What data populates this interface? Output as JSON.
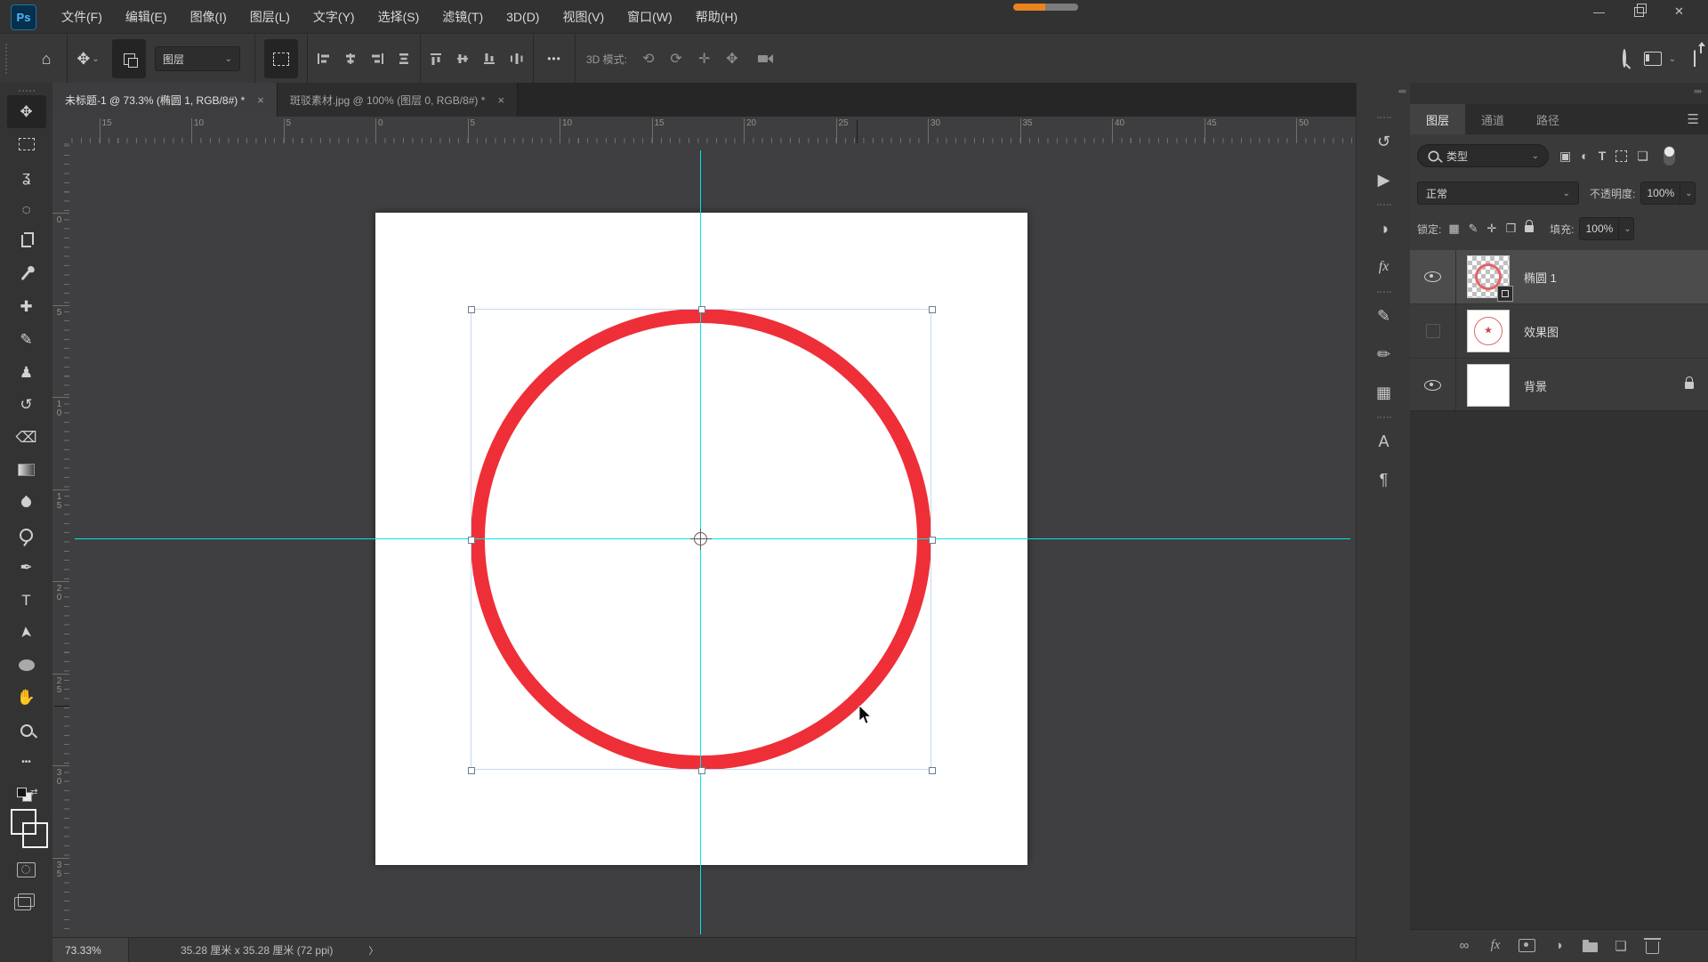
{
  "window": {
    "app_logo": "Ps",
    "controls": {
      "minimize": "—",
      "close": "✕"
    }
  },
  "menu_bar": {
    "items": [
      {
        "id": "file",
        "label": "文件(F)"
      },
      {
        "id": "edit",
        "label": "编辑(E)"
      },
      {
        "id": "image",
        "label": "图像(I)"
      },
      {
        "id": "layer",
        "label": "图层(L)"
      },
      {
        "id": "type",
        "label": "文字(Y)"
      },
      {
        "id": "select",
        "label": "选择(S)"
      },
      {
        "id": "filter",
        "label": "滤镜(T)"
      },
      {
        "id": "3d",
        "label": "3D(D)"
      },
      {
        "id": "view",
        "label": "视图(V)"
      },
      {
        "id": "window",
        "label": "窗口(W)"
      },
      {
        "id": "help",
        "label": "帮助(H)"
      }
    ]
  },
  "options_bar": {
    "tool_select_label": "图层",
    "mode_label": "3D 模式:",
    "more_label": "•••"
  },
  "icons": {
    "home": "⌂",
    "chevron_down": "⌄",
    "hamburger": "☰",
    "collapse_left": "««",
    "collapse_right": "»»",
    "rotate3d": "⟲",
    "roll3d": "⟳",
    "drag3d": "✛",
    "slide3d": "✥",
    "filter_image": "▣",
    "filter_adjust": "◐",
    "filter_type": "T",
    "filter_smart": "❏",
    "lock_checker": "▦",
    "lock_brush": "✎",
    "lock_position": "✛",
    "lock_artboard": "❐",
    "star": "★",
    "status_chevron": "〉",
    "mini_swap_arrow": "⇄"
  },
  "tabs": [
    {
      "label": "未标题-1 @ 73.3% (椭圆 1, RGB/8#) *",
      "close": "×",
      "active": true
    },
    {
      "label": "斑驳素材.jpg @ 100% (图层 0, RGB/8#) *",
      "close": "×",
      "active": false
    }
  ],
  "toolbar": {
    "tools": [
      {
        "name": "move-tool",
        "glyph": "✥",
        "active": true
      },
      {
        "name": "rect-marquee-tool",
        "shape": "marquee"
      },
      {
        "name": "lasso-tool",
        "glyph": "ʓ"
      },
      {
        "name": "quick-selection-tool",
        "glyph": "◌"
      },
      {
        "name": "crop-tool",
        "shape": "crop"
      },
      {
        "name": "eyedropper-tool",
        "shape": "dropper"
      },
      {
        "name": "spot-healing-tool",
        "glyph": "✚"
      },
      {
        "name": "brush-tool",
        "glyph": "✎"
      },
      {
        "name": "clone-stamp-tool",
        "glyph": "♟"
      },
      {
        "name": "history-brush-tool",
        "glyph": "↺"
      },
      {
        "name": "eraser-tool",
        "glyph": "⌫"
      },
      {
        "name": "gradient-tool",
        "shape": "grad"
      },
      {
        "name": "blur-tool",
        "shape": "drop"
      },
      {
        "name": "dodge-tool",
        "shape": "dodge"
      },
      {
        "name": "pen-tool",
        "glyph": "✒"
      },
      {
        "name": "type-tool",
        "glyph": "T"
      },
      {
        "name": "path-selection-tool",
        "glyph": "➤",
        "rot": true
      },
      {
        "name": "ellipse-tool",
        "shape": "ellipse"
      },
      {
        "name": "hand-tool",
        "glyph": "✋"
      },
      {
        "name": "zoom-tool",
        "shape": "mag"
      },
      {
        "name": "more-tools",
        "glyph": "•••"
      }
    ]
  },
  "rulers": {
    "top_labels": [
      "15",
      "10",
      "5",
      "0",
      "5",
      "10",
      "15",
      "20",
      "25",
      "30",
      "35",
      "40",
      "45",
      "50"
    ],
    "left_labels": [
      "0",
      "5",
      "10",
      "15",
      "20",
      "25",
      "30",
      "35"
    ]
  },
  "canvas": {
    "circle_color": "#ee2f38",
    "guide_color": "#00e4e6"
  },
  "status_bar": {
    "zoom": "73.33%",
    "doc_size": "35.28 厘米 x 35.28 厘米 (72 ppi)"
  },
  "panels": {
    "strip_icons": [
      {
        "name": "history-icon",
        "glyph": "↺"
      },
      {
        "name": "actions-icon",
        "glyph": "▶"
      },
      {
        "name": "adjustments-icon",
        "glyph": "◑"
      },
      {
        "name": "styles-icon",
        "glyph": "fx"
      },
      {
        "name": "brush-settings-icon",
        "glyph": "✎"
      },
      {
        "name": "brushes-icon",
        "glyph": "✏"
      },
      {
        "name": "patterns-icon",
        "glyph": "▦"
      },
      {
        "name": "character-icon",
        "glyph": "A"
      },
      {
        "name": "paragraph-icon",
        "glyph": "¶"
      }
    ],
    "tabs": [
      {
        "id": "layers",
        "label": "图层",
        "active": true
      },
      {
        "id": "channels",
        "label": "通道",
        "active": false
      },
      {
        "id": "paths",
        "label": "路径",
        "active": false
      }
    ],
    "filter": {
      "type_label": "类型"
    },
    "blend_mode": "正常",
    "opacity_label": "不透明度:",
    "opacity_value": "100%",
    "lock_label": "锁定:",
    "fill_label": "填充:",
    "fill_value": "100%",
    "layers": [
      {
        "id": "ellipse",
        "name": "椭圆 1",
        "visible": true,
        "selected": true,
        "locked": false,
        "thumb": "ellipse"
      },
      {
        "id": "effect",
        "name": "效果图",
        "visible": false,
        "selected": false,
        "locked": false,
        "thumb": "seal"
      },
      {
        "id": "background",
        "name": "背景",
        "visible": true,
        "selected": false,
        "locked": true,
        "thumb": "white"
      }
    ],
    "bottom_icons": [
      {
        "name": "link-layers-icon",
        "glyph": "∞"
      },
      {
        "name": "layer-effects-icon",
        "glyph": "fx",
        "fx": true
      },
      {
        "name": "layer-mask-icon",
        "shape": "maskico"
      },
      {
        "name": "adjustment-layer-icon",
        "glyph": "◑"
      },
      {
        "name": "layer-group-icon",
        "shape": "folderico"
      },
      {
        "name": "new-layer-icon",
        "glyph": "❏"
      },
      {
        "name": "delete-layer-icon",
        "shape": "trashico"
      }
    ]
  },
  "colors": {
    "foreground_swatch": "#f23d45",
    "background_swatch": "#ef8a66",
    "progress_orange": "#e8831d"
  }
}
